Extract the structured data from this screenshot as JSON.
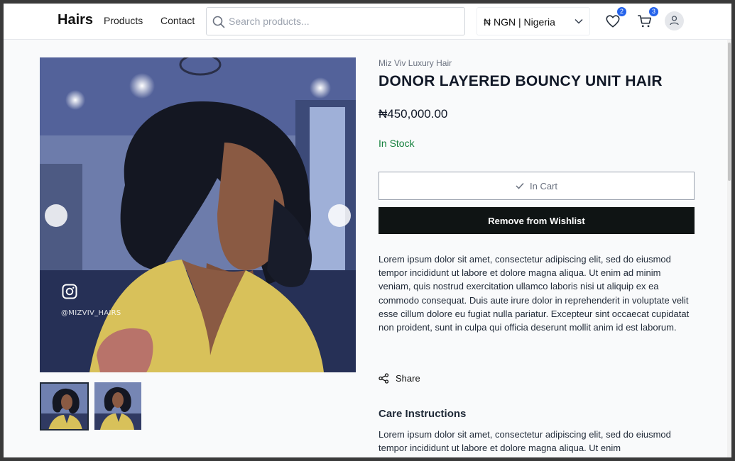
{
  "header": {
    "logo": "Hairs",
    "nav": [
      "Products",
      "Contact"
    ],
    "search_placeholder": "Search products...",
    "currency": "₦ NGN | Nigeria",
    "wishlist_count": "2",
    "cart_count": "3"
  },
  "gallery": {
    "watermark": "@MIZVIV_HAIRS",
    "thumbnail_count": 2,
    "selected_thumbnail": 1
  },
  "product": {
    "brand": "Miz Viv Luxury Hair",
    "title": "DONOR LAYERED BOUNCY UNIT HAIR",
    "price": "₦450,000.00",
    "stock": "In Stock",
    "in_cart_label": "In Cart",
    "wishlist_label": "Remove from Wishlist",
    "description": "Lorem ipsum dolor sit amet, consectetur adipiscing elit, sed do eiusmod tempor incididunt ut labore et dolore magna aliqua. Ut enim ad minim veniam, quis nostrud exercitation ullamco laboris nisi ut aliquip ex ea commodo consequat. Duis aute irure dolor in reprehenderit in voluptate velit esse cillum dolore eu fugiat nulla pariatur. Excepteur sint occaecat cupidatat non proident, sunt in culpa qui officia deserunt mollit anim id est laborum.",
    "share_label": "Share",
    "care_title": "Care Instructions",
    "care_text": "Lorem ipsum dolor sit amet, consectetur adipiscing elit, sed do eiusmod tempor incididunt ut labore et dolore magna aliqua. Ut enim"
  },
  "colors": {
    "accent": "#2563eb",
    "stock_green": "#15803d",
    "button_dark": "#0f1414"
  }
}
